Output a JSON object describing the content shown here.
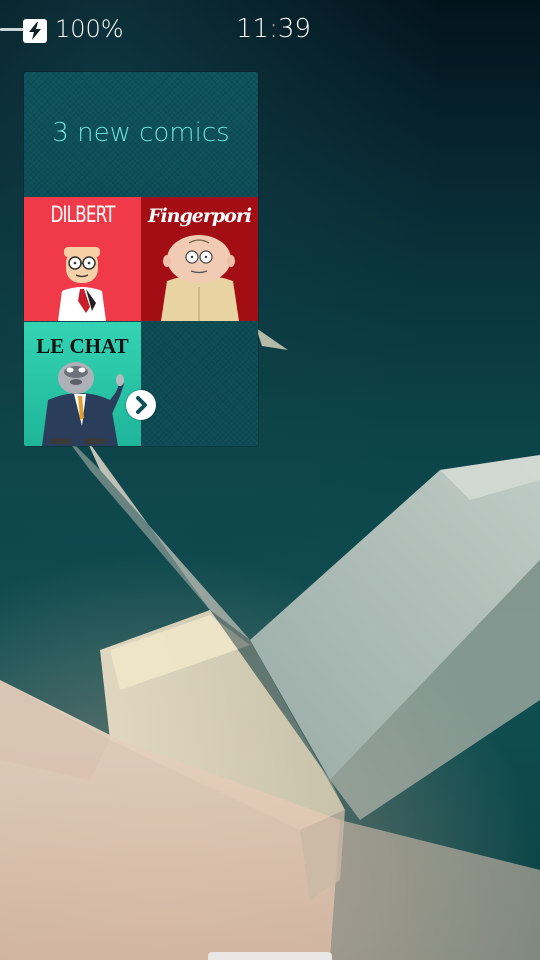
{
  "status_bar": {
    "battery_percent": "100%",
    "time": "11:39",
    "charging_icon": "charging-bolt-icon"
  },
  "cover": {
    "title": "3 new comics",
    "comics": [
      {
        "name": "DILBERT",
        "color": "#f03a4a"
      },
      {
        "name": "Fingerpori",
        "color": "#a30d14"
      },
      {
        "name": "LE CHAT",
        "color": "#2ac9a8"
      }
    ],
    "next_icon": "chevron-right-icon"
  },
  "colors": {
    "accent": "#6fe0d8",
    "background": "#0c4448"
  }
}
